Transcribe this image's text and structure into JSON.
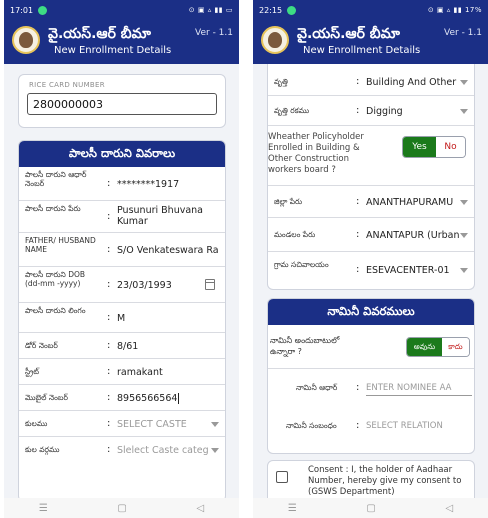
{
  "left": {
    "status_time": "17:01",
    "status_icons": "⊙ ▣ ▵ ▮▮ ▭",
    "app_title": "వై.యస్.ఆర్ బీమా",
    "app_subtitle": "New Enrollment Details",
    "version": "Ver - 1.1",
    "rice_card": {
      "label": "RICE CARD NUMBER",
      "value": "2800000003"
    },
    "section_title": "పాలసీ దారుని వివరాలు",
    "rows": [
      {
        "label": "పాలసీ దారుని ఆధార్ నెంబర్",
        "value": "********1917"
      },
      {
        "label": "పాలసీ దారుని పేరు",
        "value": "Pusunuri Bhuvana Kumar"
      },
      {
        "label": "FATHER/ HUSBAND NAME",
        "value": "S/O Venkateswara Ra"
      },
      {
        "label": "పాలసీ దారుని DOB (dd-mm -yyyy)",
        "value": "23/03/1993"
      },
      {
        "label": "పాలసీ దారుని లింగం",
        "value": "M"
      },
      {
        "label": "డోర్ నెంబర్",
        "value": "8/61"
      },
      {
        "label": "స్ట్రీట్",
        "value": "ramakant"
      },
      {
        "label": "మొబైల్ నెంబర్",
        "value": "8956566564"
      },
      {
        "label": "కులము",
        "value": "SELECT CASTE"
      },
      {
        "label": "కుల వర్గము",
        "value": "Slelect Caste categ"
      }
    ]
  },
  "right": {
    "status_time": "22:15",
    "status_icons": "⊙ ▣ ▵ ▮▮ 17%",
    "app_title": "వై.యస్.ఆర్ బీమా",
    "app_subtitle": "New Enrollment Details",
    "version": "Ver - 1.1",
    "rows_top": [
      {
        "label": "వృత్తి",
        "value": "Building And Other"
      },
      {
        "label": "వృత్తి రకము",
        "value": "Digging"
      }
    ],
    "welfare_question": "Wheather Policyholder Enrolled in Building & Other Construction workers board ?",
    "welfare_yes": "Yes",
    "welfare_no": "No",
    "rows_bottom": [
      {
        "label": "జిల్లా పేరు",
        "value": "ANANTHAPURAMU"
      },
      {
        "label": "మండలం పేరు",
        "value": "ANANTAPUR (Urban"
      },
      {
        "label": "గ్రామ సచివాలయం",
        "value": "ESEVACENTER-01"
      }
    ],
    "nominee_title": "నామినీ వివరములు",
    "nominee_question": "నామినీ అందుబాటులో ఉన్నారా ?",
    "nominee_yes": "అవును",
    "nominee_no": "కాదు",
    "nominee_aadhar_label": "నామినీ ఆధార్",
    "nominee_aadhar_placeholder": "ENTER NOMINEE AA",
    "nominee_relation_label": "నామినీ సంబంధం",
    "nominee_relation_placeholder": "SELECT RELATION",
    "consent_text": "Consent : I, the holder of Aadhaar Number, hereby give my consent to (GSWS Department)"
  },
  "nav": {
    "back": "◁",
    "home": "▢",
    "menu": "☰"
  }
}
